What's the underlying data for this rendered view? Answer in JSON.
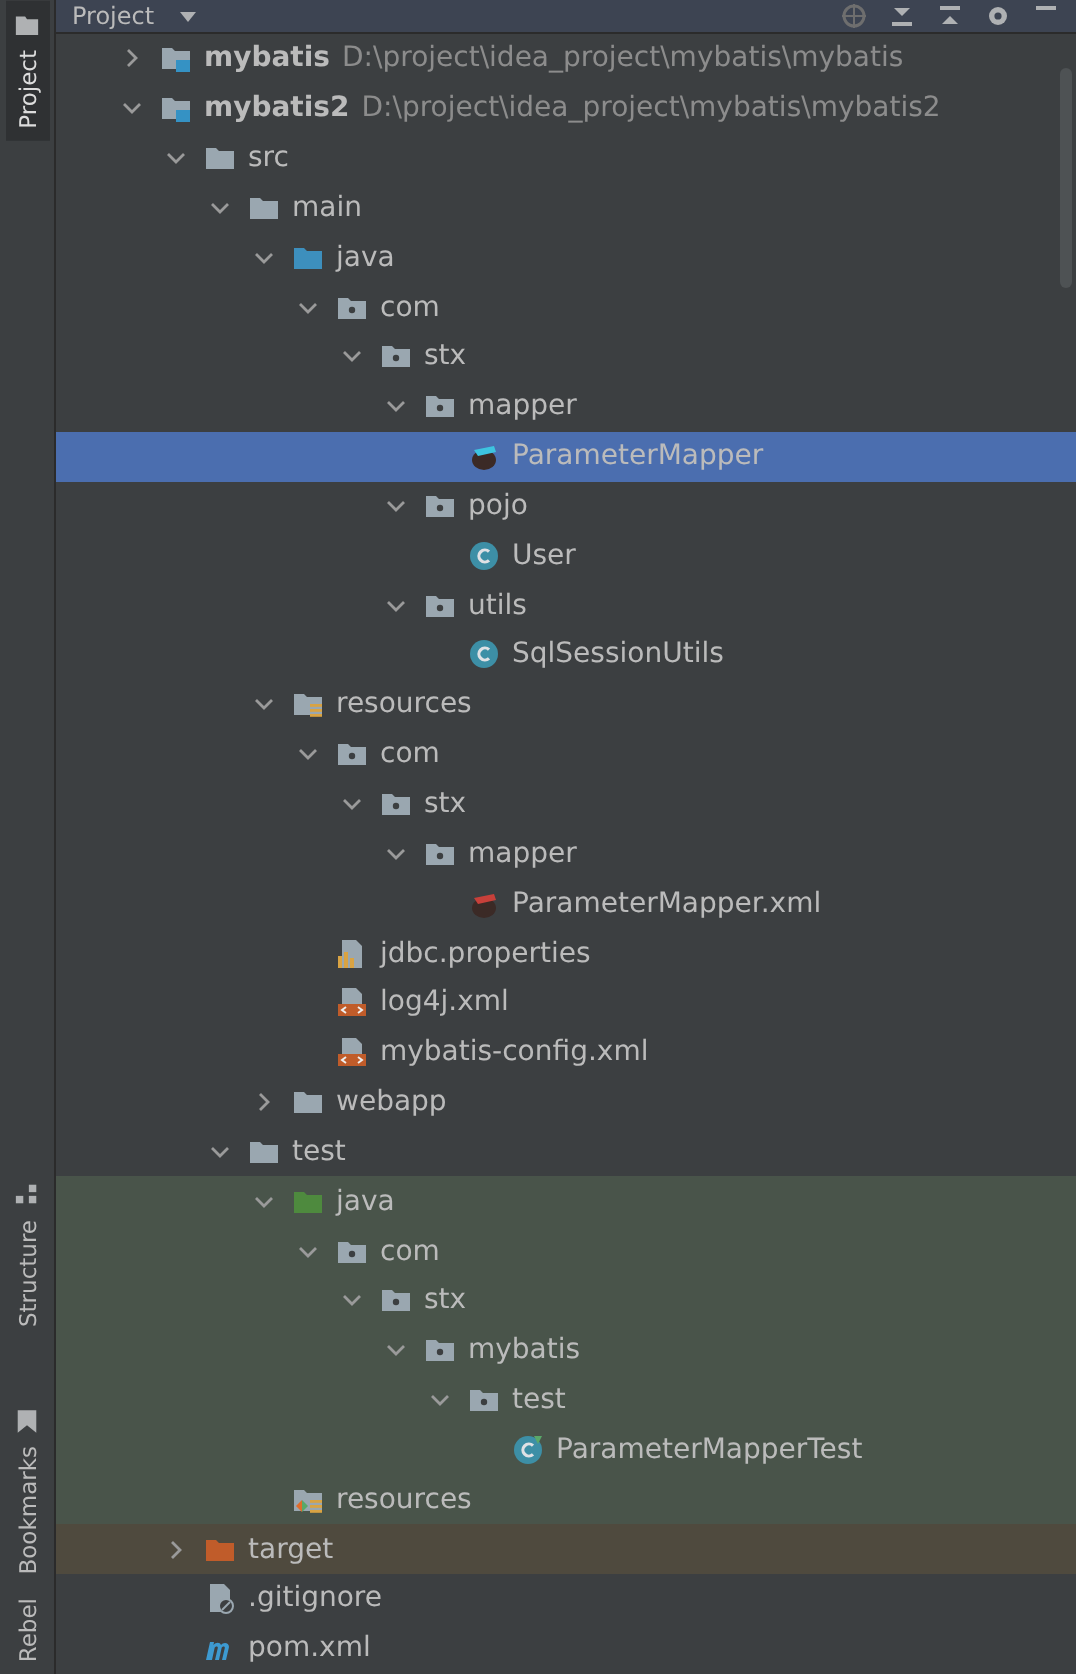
{
  "side_tabs": [
    {
      "label": "Project",
      "selected": true
    },
    {
      "label": "Structure",
      "selected": false
    },
    {
      "label": "Bookmarks",
      "selected": false
    },
    {
      "label": "Rebel",
      "selected": false
    }
  ],
  "panel": {
    "title": "Project"
  },
  "tree": [
    {
      "name": "mybatis",
      "path": "D:\\project\\idea_project\\mybatis\\mybatis",
      "kind": "module",
      "expanded": false,
      "selected": false
    },
    {
      "name": "mybatis2",
      "path": "D:\\project\\idea_project\\mybatis\\mybatis2",
      "kind": "module",
      "expanded": true,
      "selected": false,
      "children": [
        {
          "name": "src",
          "kind": "folder",
          "expanded": true,
          "selected": false,
          "children": [
            {
              "name": "main",
              "kind": "folder",
              "expanded": true,
              "selected": false,
              "children": [
                {
                  "name": "java",
                  "kind": "src",
                  "expanded": true,
                  "selected": false,
                  "children": [
                    {
                      "name": "com",
                      "kind": "pkg",
                      "expanded": true,
                      "selected": false,
                      "children": [
                        {
                          "name": "stx",
                          "kind": "pkg",
                          "expanded": true,
                          "selected": false,
                          "children": [
                            {
                              "name": "mapper",
                              "kind": "pkg",
                              "expanded": true,
                              "selected": false,
                              "children": [
                                {
                                  "name": "ParameterMapper",
                                  "kind": "mapper",
                                  "selected": true
                                }
                              ]
                            },
                            {
                              "name": "pojo",
                              "kind": "pkg",
                              "expanded": true,
                              "selected": false,
                              "children": [
                                {
                                  "name": "User",
                                  "kind": "class",
                                  "selected": false
                                }
                              ]
                            },
                            {
                              "name": "utils",
                              "kind": "pkg",
                              "expanded": true,
                              "selected": false,
                              "children": [
                                {
                                  "name": "SqlSessionUtils",
                                  "kind": "class",
                                  "selected": false
                                }
                              ]
                            }
                          ]
                        }
                      ]
                    }
                  ]
                },
                {
                  "name": "resources",
                  "kind": "res",
                  "expanded": true,
                  "selected": false,
                  "children": [
                    {
                      "name": "com",
                      "kind": "pkg",
                      "expanded": true,
                      "selected": false,
                      "children": [
                        {
                          "name": "stx",
                          "kind": "pkg",
                          "expanded": true,
                          "selected": false,
                          "children": [
                            {
                              "name": "mapper",
                              "kind": "pkg",
                              "expanded": true,
                              "selected": false,
                              "children": [
                                {
                                  "name": "ParameterMapper.xml",
                                  "kind": "mapperxml",
                                  "selected": false
                                }
                              ]
                            }
                          ]
                        }
                      ]
                    },
                    {
                      "name": "jdbc.properties",
                      "kind": "props",
                      "selected": false
                    },
                    {
                      "name": "log4j.xml",
                      "kind": "xml",
                      "selected": false
                    },
                    {
                      "name": "mybatis-config.xml",
                      "kind": "xml",
                      "selected": false
                    }
                  ]
                },
                {
                  "name": "webapp",
                  "kind": "folder",
                  "expanded": false,
                  "selected": false
                }
              ]
            },
            {
              "name": "test",
              "kind": "folder",
              "expanded": true,
              "selected": false,
              "children": [
                {
                  "name": "java",
                  "kind": "testsrc",
                  "test_scope": true,
                  "expanded": true,
                  "selected": false,
                  "children": [
                    {
                      "name": "com",
                      "kind": "pkg",
                      "test_scope": true,
                      "expanded": true,
                      "selected": false,
                      "children": [
                        {
                          "name": "stx",
                          "kind": "pkg",
                          "test_scope": true,
                          "expanded": true,
                          "selected": false,
                          "children": [
                            {
                              "name": "mybatis",
                              "kind": "pkg",
                              "test_scope": true,
                              "expanded": true,
                              "selected": false,
                              "children": [
                                {
                                  "name": "test",
                                  "kind": "pkg",
                                  "test_scope": true,
                                  "expanded": true,
                                  "selected": false,
                                  "children": [
                                    {
                                      "name": "ParameterMapperTest",
                                      "kind": "testclass",
                                      "test_scope": true,
                                      "selected": false
                                    }
                                  ]
                                }
                              ]
                            }
                          ]
                        }
                      ]
                    }
                  ]
                },
                {
                  "name": "resources",
                  "kind": "testres",
                  "test_scope": true,
                  "selected": false
                }
              ]
            }
          ]
        },
        {
          "name": "target",
          "kind": "excluded",
          "excluded": true,
          "expanded": false,
          "selected": false
        },
        {
          "name": ".gitignore",
          "kind": "file",
          "selected": false
        },
        {
          "name": "pom.xml",
          "kind": "maven",
          "selected": false
        }
      ]
    }
  ]
}
